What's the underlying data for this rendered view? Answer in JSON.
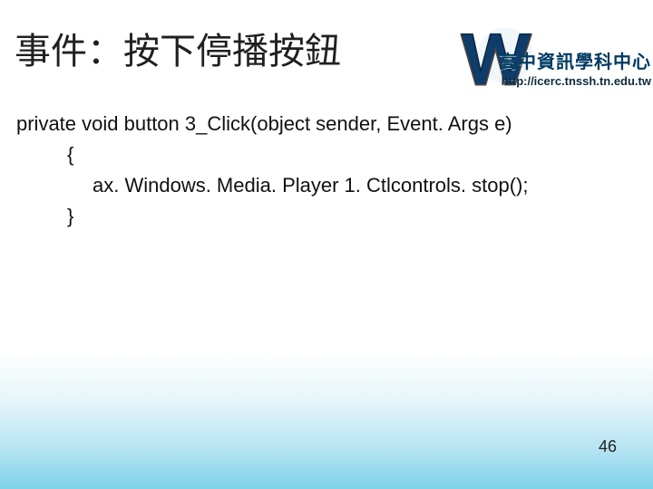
{
  "header": {
    "brand_title": "高中資訊學科中心",
    "brand_url": "http://icerc.tnssh.tn.edu.tw",
    "logo_name": "w-logo"
  },
  "slide": {
    "title": "事件：按下停播按鈕",
    "page_number": "46"
  },
  "code": {
    "line1": "private void button 3_Click(object sender, Event. Args e)",
    "line2": "{",
    "line3": "ax. Windows. Media. Player 1. Ctlcontrols. stop();",
    "line4": "}"
  }
}
